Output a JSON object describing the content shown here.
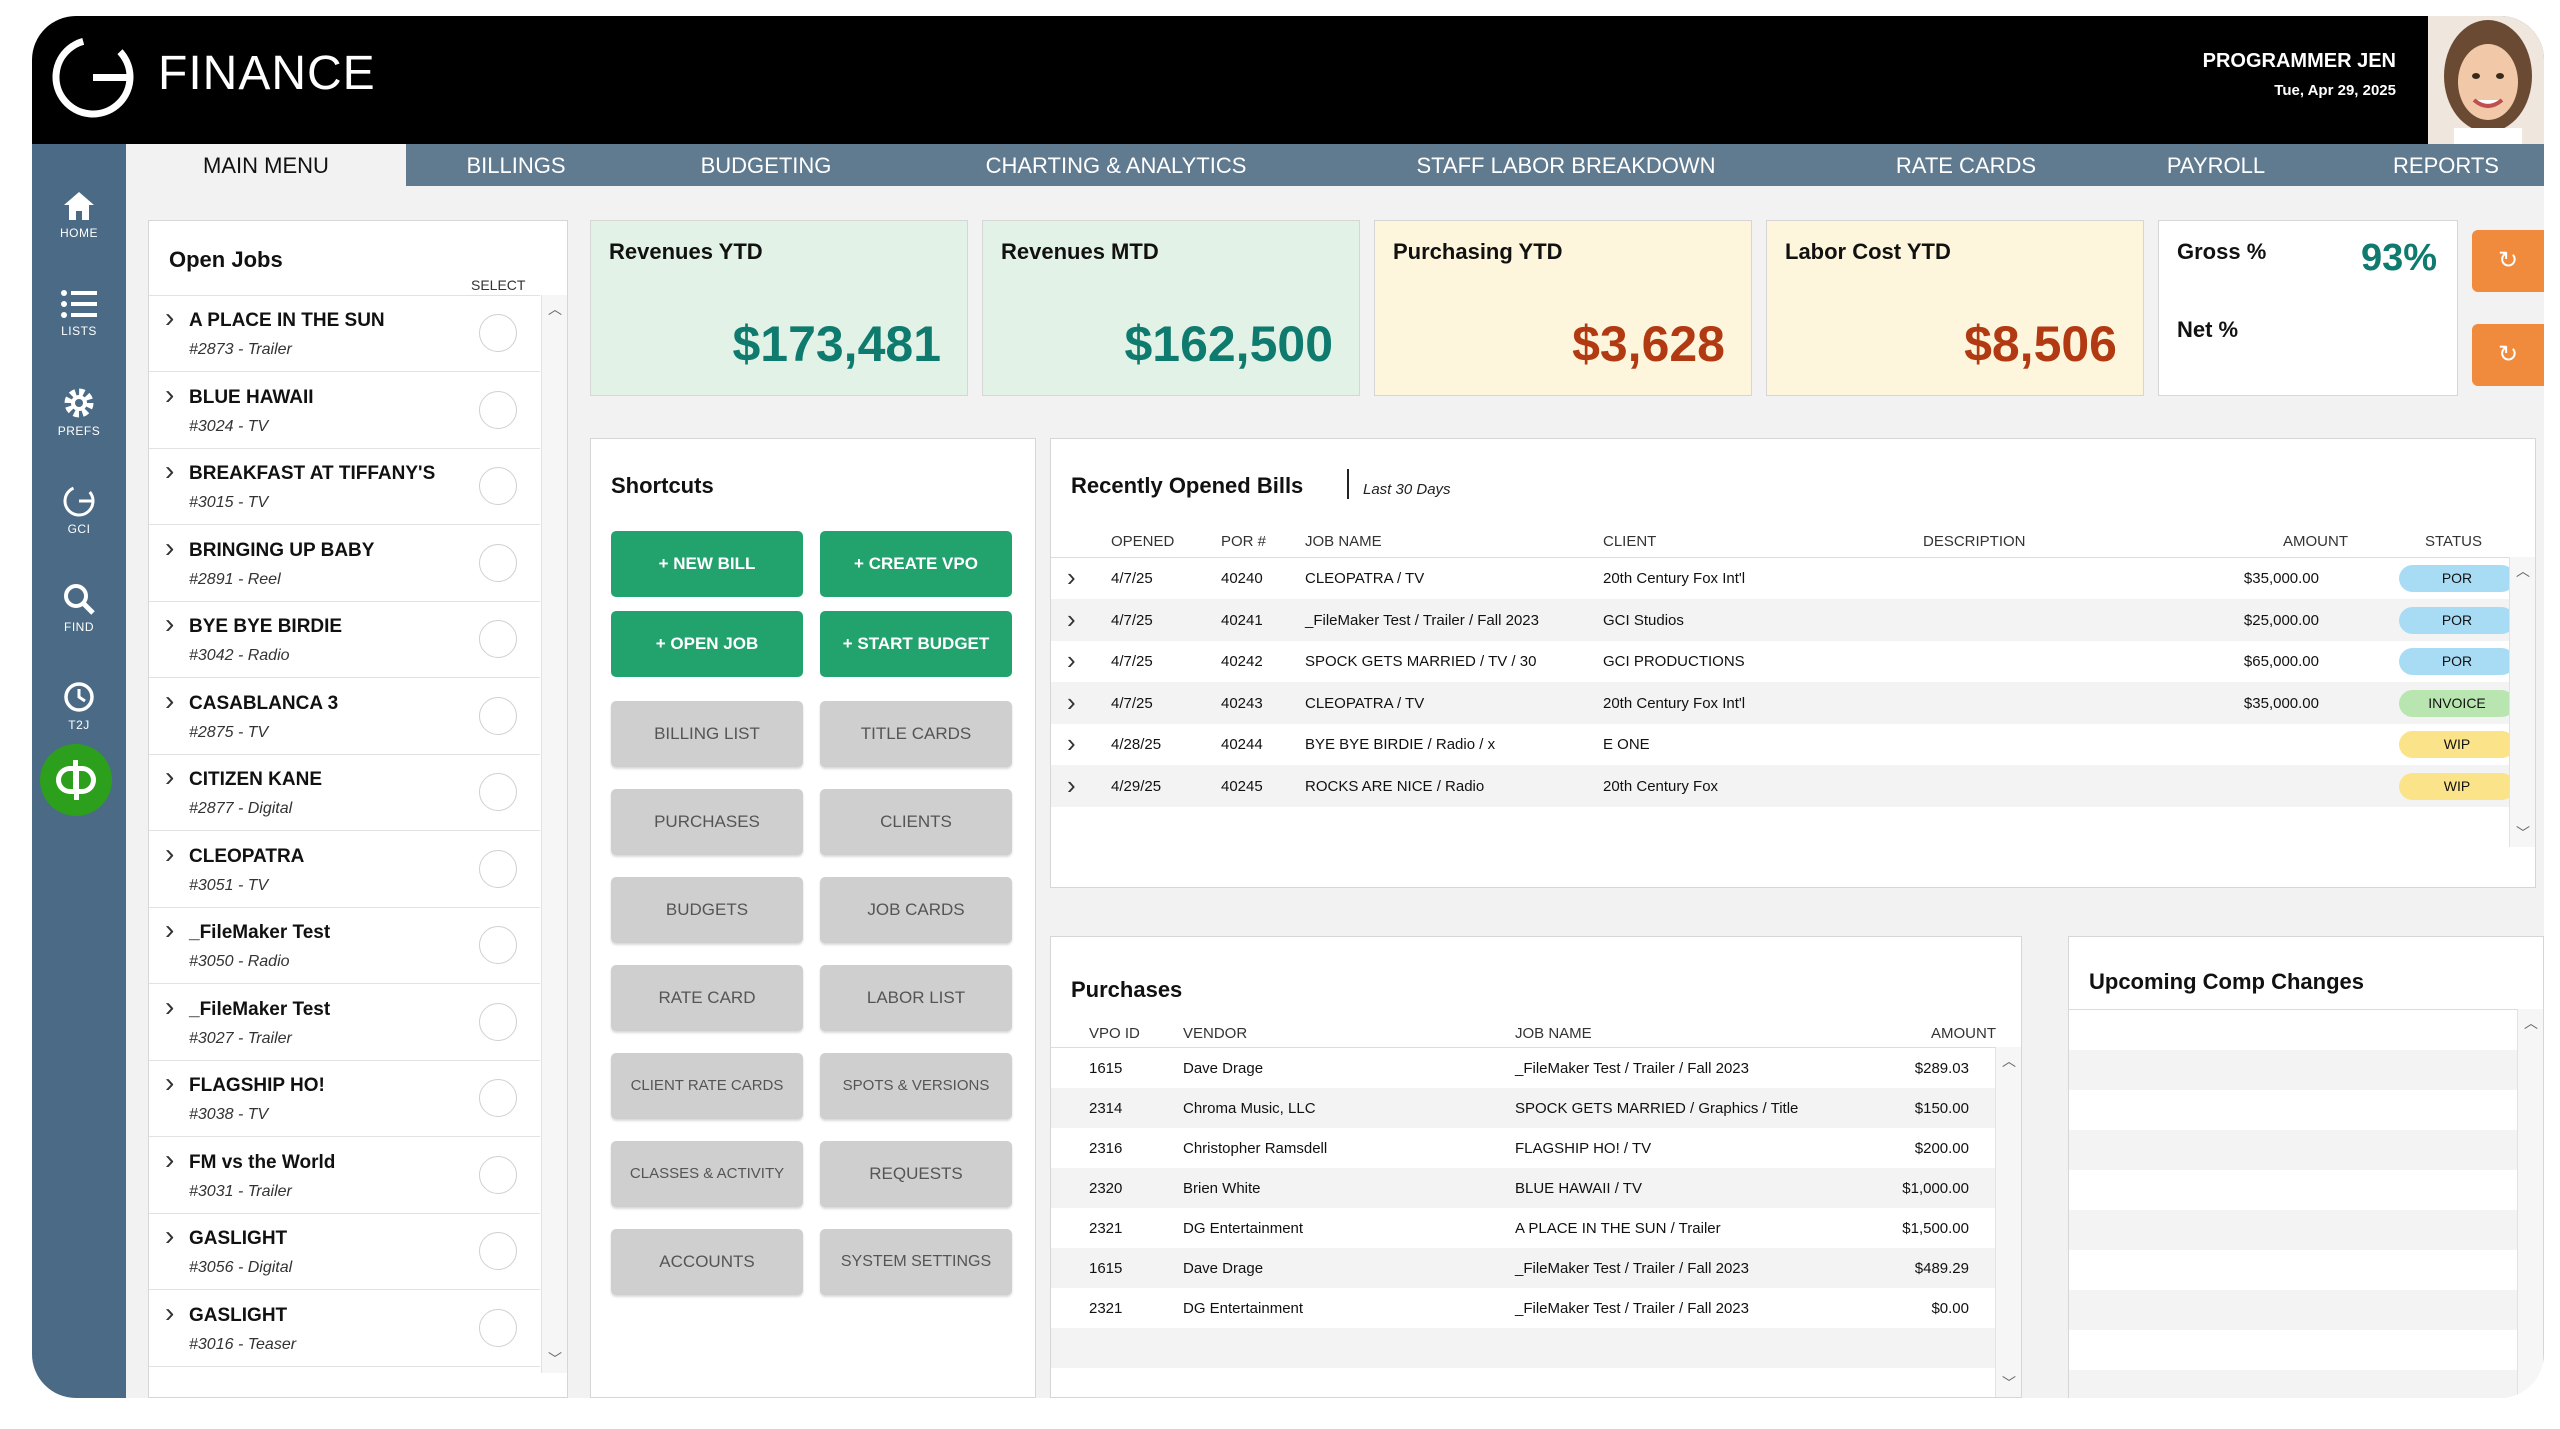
{
  "app": {
    "title": "FINANCE"
  },
  "user": {
    "name": "PROGRAMMER JEN",
    "date": "Tue, Apr 29, 2025"
  },
  "sidebar": {
    "items": [
      {
        "label": "HOME",
        "icon": "home-icon"
      },
      {
        "label": "LISTS",
        "icon": "list-icon"
      },
      {
        "label": "PREFS",
        "icon": "gear-icon"
      },
      {
        "label": "GCI",
        "icon": "gci-icon"
      },
      {
        "label": "FIND",
        "icon": "search-icon"
      },
      {
        "label": "T2J",
        "icon": "clock-icon"
      }
    ],
    "qb_label": "qb"
  },
  "tabs": [
    {
      "label": "MAIN MENU",
      "active": true
    },
    {
      "label": "BILLINGS"
    },
    {
      "label": "BUDGETING"
    },
    {
      "label": "CHARTING & ANALYTICS"
    },
    {
      "label": "STAFF LABOR BREAKDOWN"
    },
    {
      "label": "RATE CARDS"
    },
    {
      "label": "PAYROLL"
    },
    {
      "label": "REPORTS"
    }
  ],
  "open_jobs": {
    "title": "Open Jobs",
    "select_label": "SELECT",
    "items": [
      {
        "name": "A PLACE IN THE SUN",
        "sub": "#2873 - Trailer"
      },
      {
        "name": "BLUE HAWAII",
        "sub": "#3024 - TV"
      },
      {
        "name": "BREAKFAST AT TIFFANY'S",
        "sub": "#3015 - TV"
      },
      {
        "name": "BRINGING UP BABY",
        "sub": "#2891 - Reel"
      },
      {
        "name": "BYE BYE BIRDIE",
        "sub": "#3042 - Radio"
      },
      {
        "name": "CASABLANCA 3",
        "sub": "#2875 - TV"
      },
      {
        "name": "CITIZEN KANE",
        "sub": "#2877 - Digital"
      },
      {
        "name": "CLEOPATRA",
        "sub": "#3051 - TV"
      },
      {
        "name": "_FileMaker Test",
        "sub": "#3050 - Radio"
      },
      {
        "name": "_FileMaker Test",
        "sub": "#3027 - Trailer"
      },
      {
        "name": "FLAGSHIP HO!",
        "sub": "#3038 - TV"
      },
      {
        "name": "FM vs the World",
        "sub": "#3031 - Trailer"
      },
      {
        "name": "GASLIGHT",
        "sub": "#3056 - Digital"
      },
      {
        "name": "GASLIGHT",
        "sub": "#3016 - Teaser"
      }
    ]
  },
  "kpis": [
    {
      "label": "Revenues YTD",
      "value": "$173,481",
      "bg": "#e3f2e6",
      "color": "#0f7a6e"
    },
    {
      "label": "Revenues MTD",
      "value": "$162,500",
      "bg": "#e3f2e6",
      "color": "#0f7a6e"
    },
    {
      "label": "Purchasing YTD",
      "value": "$3,628",
      "bg": "#fdf5dc",
      "color": "#b23a12"
    },
    {
      "label": "Labor Cost YTD",
      "value": "$8,506",
      "bg": "#fdf5dc",
      "color": "#b23a12"
    }
  ],
  "margins": {
    "gross_label": "Gross %",
    "gross_value": "93%",
    "net_label": "Net %",
    "accent": "#0f7a6e"
  },
  "refresh_buttons": [
    "↻",
    "↻"
  ],
  "shortcuts": {
    "title": "Shortcuts",
    "primary": [
      "NEW BILL",
      "CREATE VPO",
      "OPEN JOB",
      "START BUDGET"
    ],
    "secondary": [
      "BILLING LIST",
      "TITLE CARDS",
      "PURCHASES",
      "CLIENTS",
      "BUDGETS",
      "JOB CARDS",
      "RATE CARD",
      "LABOR LIST",
      "CLIENT RATE CARDS",
      "SPOTS & VERSIONS",
      "CLASSES & ACTIVITY",
      "REQUESTS",
      "ACCOUNTS",
      "SYSTEM SETTINGS"
    ]
  },
  "bills": {
    "title": "Recently Opened Bills",
    "subtitle": "Last 30 Days",
    "columns": [
      "OPENED",
      "POR #",
      "JOB NAME",
      "CLIENT",
      "DESCRIPTION",
      "AMOUNT",
      "STATUS"
    ],
    "rows": [
      {
        "opened": "4/7/25",
        "por": "40240",
        "job": "CLEOPATRA / TV",
        "client": "20th Century Fox Int'l",
        "description": "",
        "amount": "$35,000.00",
        "status": "POR",
        "status_color": "#a8dcf5"
      },
      {
        "opened": "4/7/25",
        "por": "40241",
        "job": "_FileMaker Test / Trailer / Fall 2023",
        "client": "GCI Studios",
        "description": "",
        "amount": "$25,000.00",
        "status": "POR",
        "status_color": "#a8dcf5"
      },
      {
        "opened": "4/7/25",
        "por": "40242",
        "job": "SPOCK GETS MARRIED / TV / 30",
        "client": "GCI PRODUCTIONS",
        "description": "",
        "amount": "$65,000.00",
        "status": "POR",
        "status_color": "#a8dcf5"
      },
      {
        "opened": "4/7/25",
        "por": "40243",
        "job": "CLEOPATRA / TV",
        "client": "20th Century Fox Int'l",
        "description": "",
        "amount": "$35,000.00",
        "status": "INVOICE",
        "status_color": "#b9e6b0"
      },
      {
        "opened": "4/28/25",
        "por": "40244",
        "job": "BYE BYE BIRDIE / Radio / x",
        "client": "E ONE",
        "description": "",
        "amount": "",
        "status": "WIP",
        "status_color": "#fbe38a"
      },
      {
        "opened": "4/29/25",
        "por": "40245",
        "job": "ROCKS ARE NICE / Radio",
        "client": "20th Century Fox",
        "description": "",
        "amount": "",
        "status": "WIP",
        "status_color": "#fbe38a"
      }
    ]
  },
  "purchases": {
    "title": "Purchases",
    "columns": [
      "VPO ID",
      "VENDOR",
      "JOB NAME",
      "AMOUNT"
    ],
    "rows": [
      {
        "vpo": "1615",
        "vendor": "Dave Drage",
        "job": "_FileMaker Test / Trailer / Fall 2023",
        "amount": "$289.03"
      },
      {
        "vpo": "2314",
        "vendor": "Chroma Music, LLC",
        "job": "SPOCK GETS MARRIED / Graphics / Title",
        "amount": "$150.00"
      },
      {
        "vpo": "2316",
        "vendor": "Christopher Ramsdell",
        "job": "FLAGSHIP HO! / TV",
        "amount": "$200.00"
      },
      {
        "vpo": "2320",
        "vendor": "Brien White",
        "job": "BLUE HAWAII / TV",
        "amount": "$1,000.00"
      },
      {
        "vpo": "2321",
        "vendor": "DG Entertainment",
        "job": "A PLACE IN THE SUN / Trailer",
        "amount": "$1,500.00"
      },
      {
        "vpo": "1615",
        "vendor": "Dave Drage",
        "job": "_FileMaker Test / Trailer / Fall 2023",
        "amount": "$489.29"
      },
      {
        "vpo": "2321",
        "vendor": "DG Entertainment",
        "job": "_FileMaker Test / Trailer / Fall 2023",
        "amount": "$0.00"
      }
    ]
  },
  "comp_changes": {
    "title": "Upcoming Comp Changes"
  }
}
